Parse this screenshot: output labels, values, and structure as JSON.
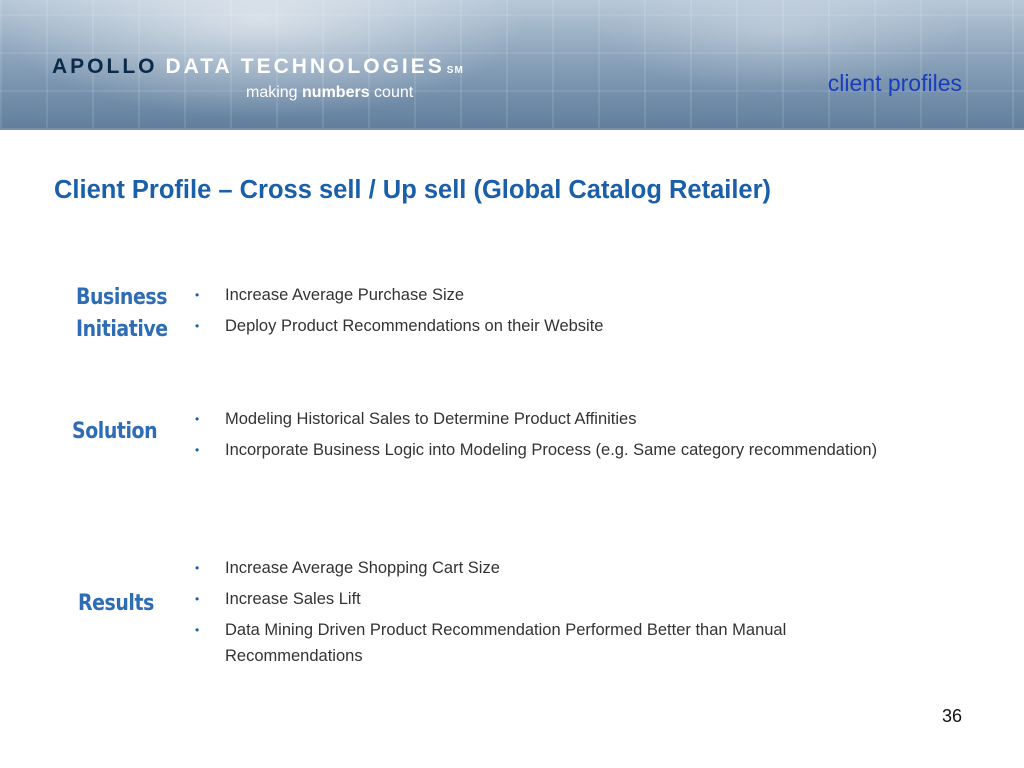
{
  "header": {
    "logo_apollo": "APOLLO",
    "logo_rest": "DATA TECHNOLOGIES",
    "logo_sm": "SM",
    "tagline_pre": "making ",
    "tagline_bold": "numbers",
    "tagline_post": " count",
    "section_label": "client profiles"
  },
  "title": "Client Profile – Cross sell / Up sell (Global Catalog Retailer)",
  "sections": {
    "business": {
      "heading_line1": "Business",
      "heading_line2": "Initiative",
      "bullets": [
        "Increase Average Purchase Size",
        "Deploy Product Recommendations on their Website"
      ]
    },
    "solution": {
      "heading": "Solution",
      "bullets": [
        "Modeling Historical Sales to Determine Product Affinities",
        "Incorporate Business Logic into Modeling Process (e.g. Same category recommendation)"
      ]
    },
    "results": {
      "heading": "Results",
      "bullets": [
        "Increase Average Shopping Cart Size",
        "Increase Sales Lift",
        "Data Mining Driven Product Recommendation Performed Better than Manual Recommendations"
      ]
    }
  },
  "bullet_glyph": "•",
  "page_number": "36",
  "colors": {
    "title": "#1a5fa8",
    "side_heading": "#2e6db3",
    "section_label": "#1a3dbd",
    "body_text": "#333333"
  }
}
